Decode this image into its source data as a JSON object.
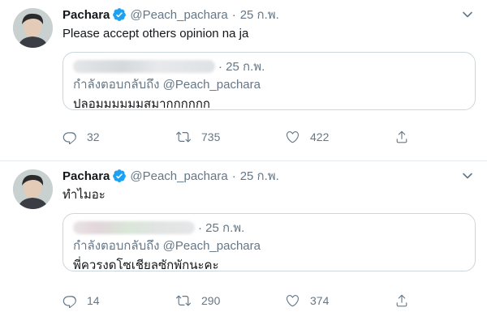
{
  "tweets": [
    {
      "name": "Pachara",
      "handle": "@Peach_pachara",
      "separator": "·",
      "date": "25 ก.พ.",
      "text": "Please accept others opinion na ja",
      "quote": {
        "date": "25 ก.พ.",
        "reply_prefix": "กำลังตอบกลับถึง",
        "reply_to": "@Peach_pachara",
        "text": "ปลอมมมมมมสมากกกกกก"
      },
      "stats": {
        "replies": "32",
        "retweets": "735",
        "likes": "422"
      }
    },
    {
      "name": "Pachara",
      "handle": "@Peach_pachara",
      "separator": "·",
      "date": "25 ก.พ.",
      "text": "ทำไมอะ",
      "quote": {
        "date": "25 ก.พ.",
        "reply_prefix": "กำลังตอบกลับถึง",
        "reply_to": "@Peach_pachara",
        "text": "พี่ควรงดโซเชียลซักพักนะคะ"
      },
      "stats": {
        "replies": "14",
        "retweets": "290",
        "likes": "374"
      }
    }
  ],
  "colors": {
    "verified": "#1da1f2",
    "muted": "#657786",
    "text": "#14171a",
    "border": "#ccd6dd"
  },
  "icons": [
    "avatar",
    "verified-badge-icon",
    "chevron-down-icon",
    "reply-icon",
    "retweet-icon",
    "like-icon",
    "share-icon"
  ]
}
